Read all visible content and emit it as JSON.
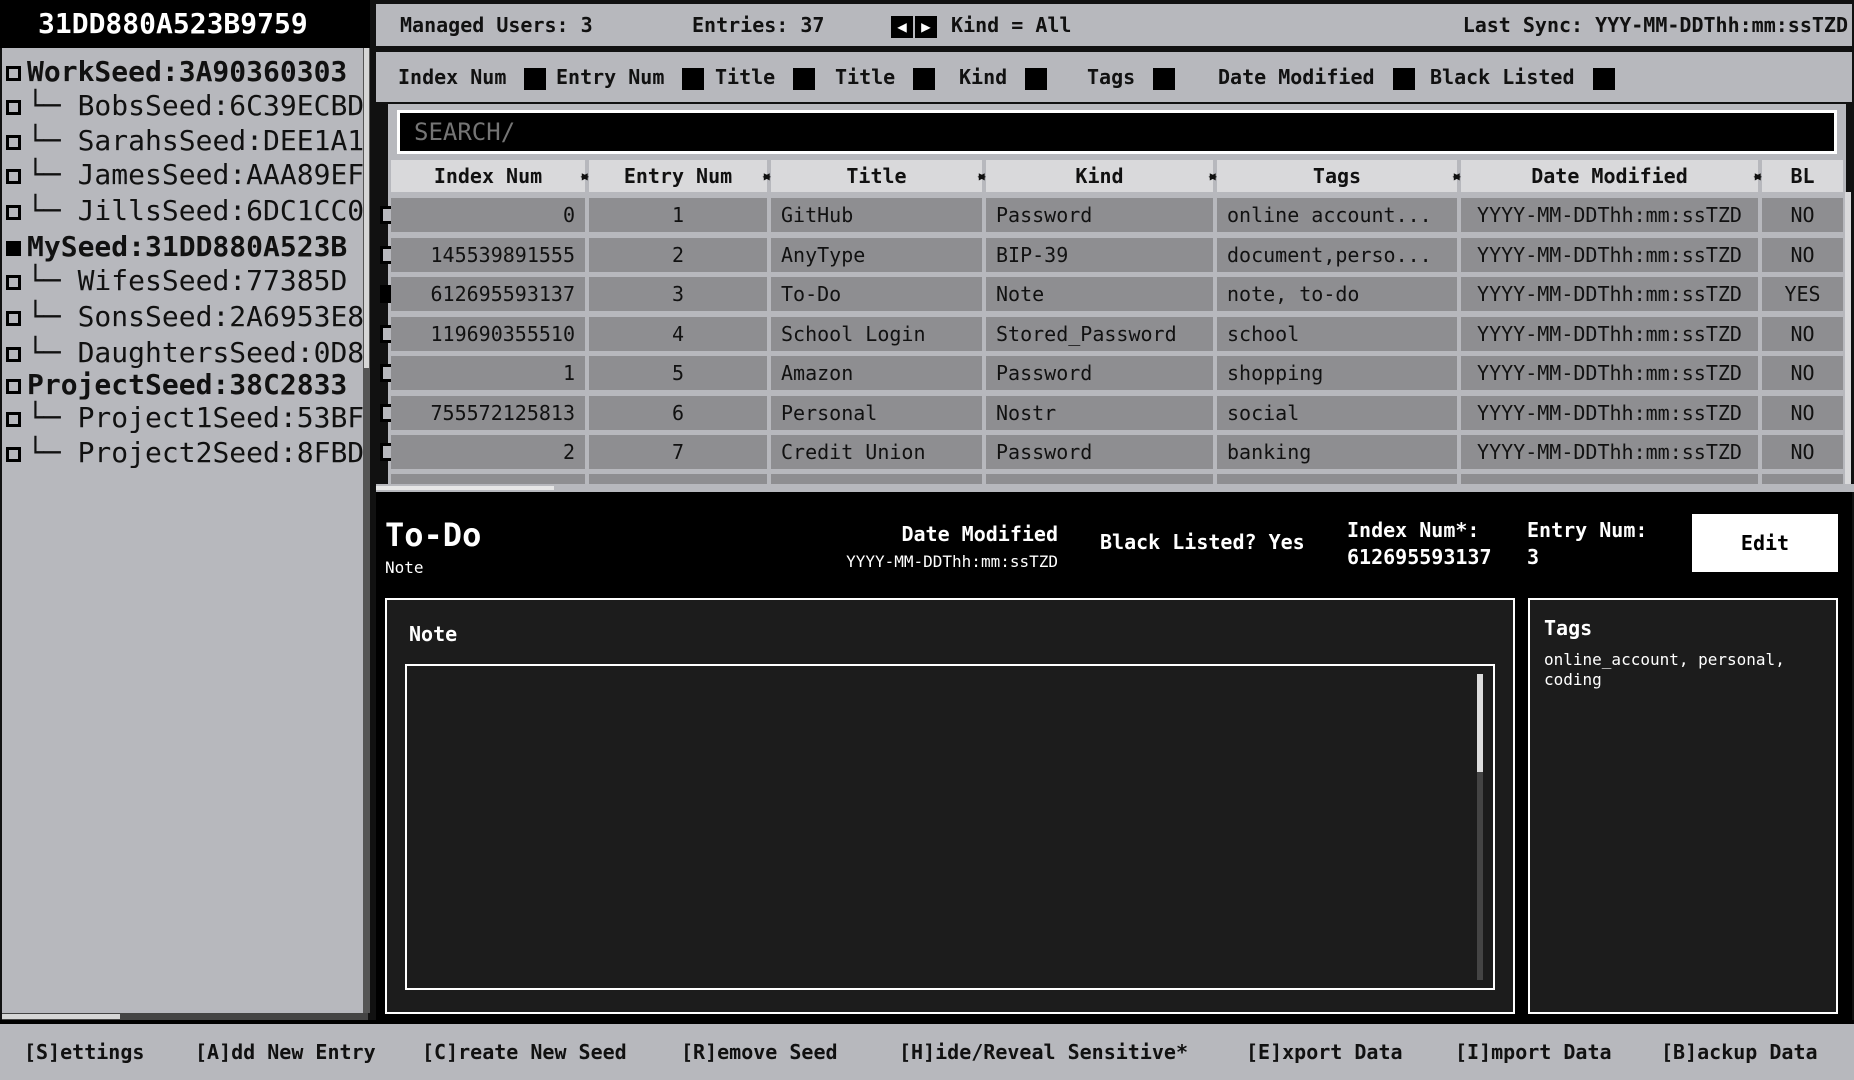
{
  "seed_header": "31DD880A523B9759",
  "tree": [
    {
      "prefix": "",
      "label": "WorkSeed:3A90360303",
      "top": true,
      "selected": false
    },
    {
      "prefix": "└─",
      "label": "BobsSeed:6C39ECBD",
      "top": false,
      "selected": false
    },
    {
      "prefix": "└─",
      "label": "SarahsSeed:DEE1A1",
      "top": false,
      "selected": false
    },
    {
      "prefix": "└─",
      "label": "JamesSeed:AAA89EF",
      "top": false,
      "selected": false
    },
    {
      "prefix": "└─",
      "label": "JillsSeed:6DC1CC0",
      "top": false,
      "selected": false
    },
    {
      "prefix": "",
      "label": "MySeed:31DD880A523B",
      "top": true,
      "selected": true
    },
    {
      "prefix": "└─",
      "label": "WifesSeed:77385D",
      "top": false,
      "selected": false
    },
    {
      "prefix": "└─",
      "label": "SonsSeed:2A6953E8",
      "top": false,
      "selected": false
    },
    {
      "prefix": "└─",
      "label": "DaughtersSeed:0D8",
      "top": false,
      "selected": false
    },
    {
      "prefix": "",
      "label": "ProjectSeed:38C2833",
      "top": true,
      "selected": false
    },
    {
      "prefix": "└─",
      "label": "Project1Seed:53BF",
      "top": false,
      "selected": false
    },
    {
      "prefix": "└─",
      "label": "Project2Seed:8FBD",
      "top": false,
      "selected": false
    }
  ],
  "topbar": {
    "managed_users": "Managed Users: 3",
    "entries": "Entries: 37",
    "prev_icon": "◀",
    "next_icon": "▶",
    "kind": "Kind = All",
    "last_sync": "Last Sync: YYY-MM-DDThh:mm:ssTZD"
  },
  "toggles": [
    "Index Num",
    "Entry Num",
    "Title",
    "Title",
    "Kind",
    "Tags",
    "Date Modified",
    "Black Listed"
  ],
  "search": {
    "placeholder": "SEARCH/"
  },
  "columns": [
    "Index Num",
    "Entry Num",
    "Title",
    "Kind",
    "Tags",
    "Date Modified",
    "BL"
  ],
  "rows": [
    {
      "index": "0",
      "entry": "1",
      "title": "GitHub",
      "kind": "Password",
      "tags": "online account...",
      "date": "YYYY-MM-DDThh:mm:ssTZD",
      "bl": "NO",
      "checked": false
    },
    {
      "index": "145539891555",
      "entry": "2",
      "title": "AnyType",
      "kind": "BIP-39",
      "tags": "document,perso...",
      "date": "YYYY-MM-DDThh:mm:ssTZD",
      "bl": "NO",
      "checked": false
    },
    {
      "index": "612695593137",
      "entry": "3",
      "title": "To-Do",
      "kind": "Note",
      "tags": "note, to-do",
      "date": "YYYY-MM-DDThh:mm:ssTZD",
      "bl": "YES",
      "checked": true
    },
    {
      "index": "119690355510",
      "entry": "4",
      "title": "School Login",
      "kind": "Stored_Password",
      "tags": "school",
      "date": "YYYY-MM-DDThh:mm:ssTZD",
      "bl": "NO",
      "checked": false
    },
    {
      "index": "1",
      "entry": "5",
      "title": "Amazon",
      "kind": "Password",
      "tags": "shopping",
      "date": "YYYY-MM-DDThh:mm:ssTZD",
      "bl": "NO",
      "checked": false
    },
    {
      "index": "755572125813",
      "entry": "6",
      "title": "Personal",
      "kind": "Nostr",
      "tags": "social",
      "date": "YYYY-MM-DDThh:mm:ssTZD",
      "bl": "NO",
      "checked": false
    },
    {
      "index": "2",
      "entry": "7",
      "title": "Credit Union",
      "kind": "Password",
      "tags": "banking",
      "date": "YYYY-MM-DDThh:mm:ssTZD",
      "bl": "NO",
      "checked": false
    }
  ],
  "detail": {
    "title": "To-Do",
    "kind": "Note",
    "date_label": "Date Modified",
    "date_value": "YYYY-MM-DDThh:mm:ssTZD",
    "black_listed": "Black Listed? Yes",
    "index_label": "Index Num*:",
    "index_value": "612695593137",
    "entry_label": "Entry Num:",
    "entry_value": "3",
    "edit_label": "Edit",
    "note_label": "Note",
    "note_value": "",
    "tags_label": "Tags",
    "tags_value": "online_account, personal, coding"
  },
  "footer": [
    "[S]ettings",
    "[A]dd New Entry",
    "[C]reate New Seed",
    "[R]emove Seed",
    "[H]ide/Reveal Sensitive*",
    "[E]xport Data",
    "[I]mport Data",
    "[B]ackup Data"
  ],
  "colors": {
    "panel": "#b7b8bd",
    "cell": "#8e8e91",
    "header": "#d9d9db",
    "background": "#000000"
  }
}
